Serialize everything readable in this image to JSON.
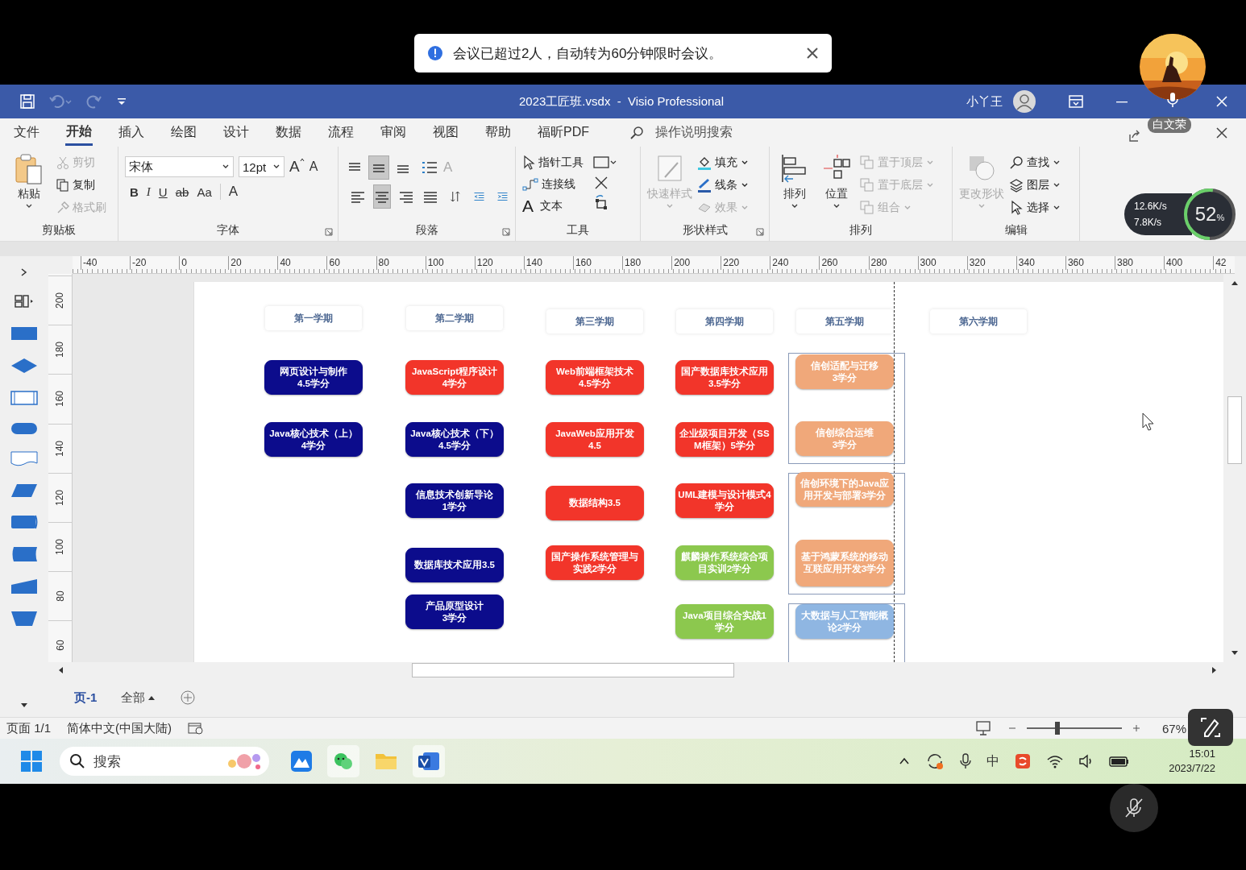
{
  "meeting_notice": {
    "text": "会议已超过2人，自动转为60分钟限时会议。"
  },
  "participant": {
    "name": "白文荣"
  },
  "window": {
    "title": "2023工匠班.vsdx  -  Visio Professional",
    "user": "小丫王"
  },
  "tabs": [
    {
      "label": "文件",
      "selected": false
    },
    {
      "label": "开始",
      "selected": true
    },
    {
      "label": "插入",
      "selected": false
    },
    {
      "label": "绘图",
      "selected": false
    },
    {
      "label": "设计",
      "selected": false
    },
    {
      "label": "数据",
      "selected": false
    },
    {
      "label": "流程",
      "selected": false
    },
    {
      "label": "审阅",
      "selected": false
    },
    {
      "label": "视图",
      "selected": false
    },
    {
      "label": "帮助",
      "selected": false
    },
    {
      "label": "福昕PDF",
      "selected": false
    }
  ],
  "tell_me": {
    "placeholder": "操作说明搜索"
  },
  "ribbon": {
    "clipboard": {
      "label": "剪贴板",
      "paste": "粘贴",
      "items": [
        {
          "label": "剪切",
          "disabled": true
        },
        {
          "label": "复制",
          "disabled": false
        },
        {
          "label": "格式刷",
          "disabled": true
        }
      ]
    },
    "font": {
      "label": "字体",
      "family": "宋体",
      "size": "12pt",
      "grow": "A",
      "shrink": "A",
      "styles": [
        "B",
        "I",
        "U",
        "ab",
        "Aa"
      ],
      "color_button": "A"
    },
    "paragraph": {
      "label": "段落",
      "text_size": "A",
      "top_row": [
        {
          "selected": false
        },
        {
          "selected": true
        },
        {
          "selected": false
        }
      ],
      "bottom_row": [
        {
          "selected": false
        },
        {
          "selected": true
        },
        {
          "selected": false
        },
        {
          "selected": false
        }
      ]
    },
    "tools": {
      "label": "工具",
      "items": [
        {
          "kind": "pointer",
          "label": "指针工具"
        },
        {
          "kind": "connector",
          "label": "连接线"
        },
        {
          "kind": "text",
          "glyph": "A",
          "label": "文本"
        }
      ]
    },
    "shape_styles": {
      "label": "形状样式",
      "quick": {
        "label": "快速样式",
        "disabled": true
      },
      "items": [
        {
          "label": "填充",
          "disabled": false
        },
        {
          "label": "线条",
          "disabled": false
        },
        {
          "label": "效果",
          "disabled": true
        }
      ]
    },
    "arrange": {
      "label": "排列",
      "big": [
        "排列",
        "位置"
      ],
      "items": [
        {
          "label": "置于顶层",
          "disabled": true
        },
        {
          "label": "置于底层",
          "disabled": true
        },
        {
          "label": "组合",
          "disabled": true
        }
      ]
    },
    "editing": {
      "label": "编辑",
      "change_shape": {
        "label": "更改形状",
        "disabled": true
      },
      "items": [
        {
          "kind": "find",
          "label": "查找"
        },
        {
          "kind": "layers",
          "label": "图层"
        },
        {
          "kind": "select",
          "label": "选择"
        }
      ]
    }
  },
  "ruler": {
    "h_labels": [
      "-40",
      "-20",
      "0",
      "20",
      "40",
      "60",
      "80",
      "100",
      "120",
      "140",
      "160",
      "180",
      "200",
      "220",
      "240",
      "260",
      "280",
      "300",
      "320",
      "340",
      "360",
      "380",
      "400",
      "42"
    ],
    "v_labels": [
      "200",
      "180",
      "160",
      "140",
      "120",
      "100",
      "80",
      "60"
    ]
  },
  "diagram": {
    "semesters": [
      {
        "title": "第一学期",
        "courses": [
          {
            "name": "网页设计与制作\n4.5学分",
            "color": "#0c0c8c"
          },
          {
            "name": "Java核心技术（上）\n4学分",
            "color": "#0c0c8c"
          }
        ]
      },
      {
        "title": "第二学期",
        "courses": [
          {
            "name": "JavaScript程序设计\n4学分",
            "color": "#f2352a"
          },
          {
            "name": "Java核心技术（下）\n4.5学分",
            "color": "#0c0c8c"
          },
          {
            "name": "信息技术创新导论\n1学分",
            "color": "#0c0c8c"
          },
          {
            "name": "数据库技术应用3.5",
            "color": "#0c0c8c"
          },
          {
            "name": "产品原型设计\n3学分",
            "color": "#0c0c8c"
          }
        ]
      },
      {
        "title": "第三学期",
        "courses": [
          {
            "name": "Web前端框架技术\n4.5学分",
            "color": "#f2352a"
          },
          {
            "name": "JavaWeb应用开发\n4.5",
            "color": "#f2352a"
          },
          {
            "name": "数据结构3.5",
            "color": "#f2352a"
          },
          {
            "name": "国产操作系统管理与实践2学分",
            "color": "#f2352a"
          }
        ]
      },
      {
        "title": "第四学期",
        "courses": [
          {
            "name": "国产数据库技术应用3.5学分",
            "color": "#f2352a"
          },
          {
            "name": "企业级项目开发（SSM框架）5学分",
            "color": "#f2352a"
          },
          {
            "name": "UML建模与设计模式4学分",
            "color": "#f2352a"
          },
          {
            "name": "麒麟操作系统综合项目实训2学分",
            "color": "#8cc84e"
          },
          {
            "name": "Java项目综合实战1\n学分",
            "color": "#8cc84e"
          }
        ]
      },
      {
        "title": "第五学期",
        "courses": [
          {
            "name": "信创适配与迁移\n3学分",
            "color": "#f0a87a"
          },
          {
            "name": "信创综合运维\n3学分",
            "color": "#f0a87a"
          },
          {
            "name": "信创环境下的Java应用开发与部署3学分",
            "color": "#f0a87a"
          },
          {
            "name": "基于鸿蒙系统的移动互联应用开发3学分",
            "color": "#f0a87a"
          },
          {
            "name": "大数据与人工智能概论2学分",
            "color": "#8fb6e2"
          }
        ]
      },
      {
        "title": "第六学期"
      }
    ]
  },
  "page_tabs": [
    {
      "label": "页-1",
      "selected": true
    }
  ],
  "all_pages": "全部",
  "status_bar": {
    "page": "页面 1/1",
    "language": "简体中文(中国大陆)",
    "zoom": "67%",
    "zoom_level": {
      "level": 0.32
    }
  },
  "taskbar": {
    "search": {
      "placeholder": "搜索"
    },
    "ime": "中",
    "time": "15:01",
    "date": "2023/7/22"
  },
  "network": {
    "up": "12.6K/s",
    "down": "7.8K/s",
    "percent": "52",
    "percent_sign": "%",
    "level": 0.52
  }
}
